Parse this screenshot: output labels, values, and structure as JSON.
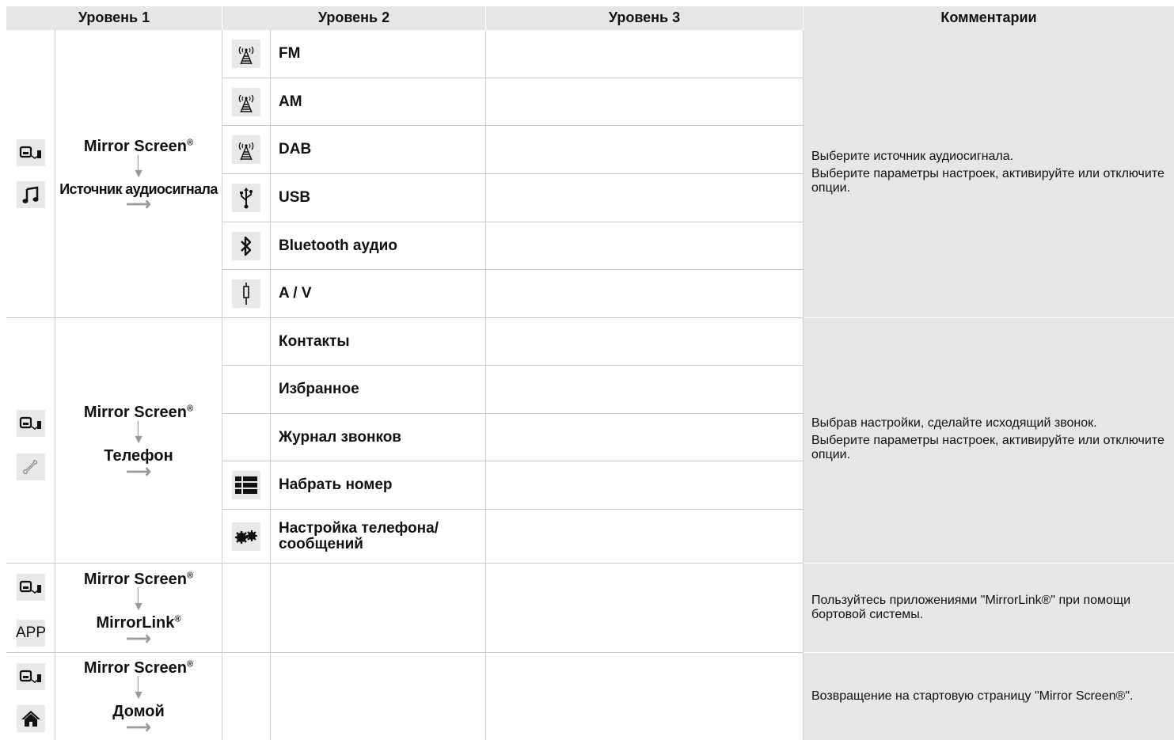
{
  "headers": {
    "level1": "Уровень 1",
    "level2": "Уровень 2",
    "level3": "Уровень 3",
    "comments": "Комментарии"
  },
  "mirror_screen": "Mirror Screen",
  "registered_mark": "®",
  "sections": {
    "audio": {
      "level1_sub": "Источник аудиосигнала",
      "items": [
        "FM",
        "AM",
        "DAB",
        "USB",
        "Bluetooth аудио",
        "A / V"
      ],
      "comment_1": "Выберите источник аудиосигнала.",
      "comment_2": "Выберите параметры настроек, активируйте или отключите опции."
    },
    "phone": {
      "level1_sub": "Телефон",
      "items": [
        "Контакты",
        "Избранное",
        "Журнал звонков",
        "Набрать номер",
        "Настройка телефона/ сообщений"
      ],
      "comment_1": "Выбрав настройки, сделайте исходящий звонок.",
      "comment_2": "Выберите параметры настроек, активируйте или отключите опции."
    },
    "mirrorlink": {
      "level1_sub": "MirrorLink",
      "app_icon_label": "APP",
      "comment": "Пользуйтесь приложениями \"MirrorLink®\" при помощи бортовой системы."
    },
    "home": {
      "level1_sub": "Домой",
      "comment": "Возвращение на стартовую страницу \"Mirror Screen®\"."
    }
  },
  "icons": {
    "mirror_screen": "mirror-screen-icon",
    "music": "music-note-icon",
    "antenna": "antenna-icon",
    "usb": "usb-icon",
    "bluetooth": "bluetooth-icon",
    "av": "av-jack-icon",
    "phone": "phone-handset-icon",
    "dialpad": "dialpad-icon",
    "settings": "gears-icon",
    "home": "home-icon"
  }
}
